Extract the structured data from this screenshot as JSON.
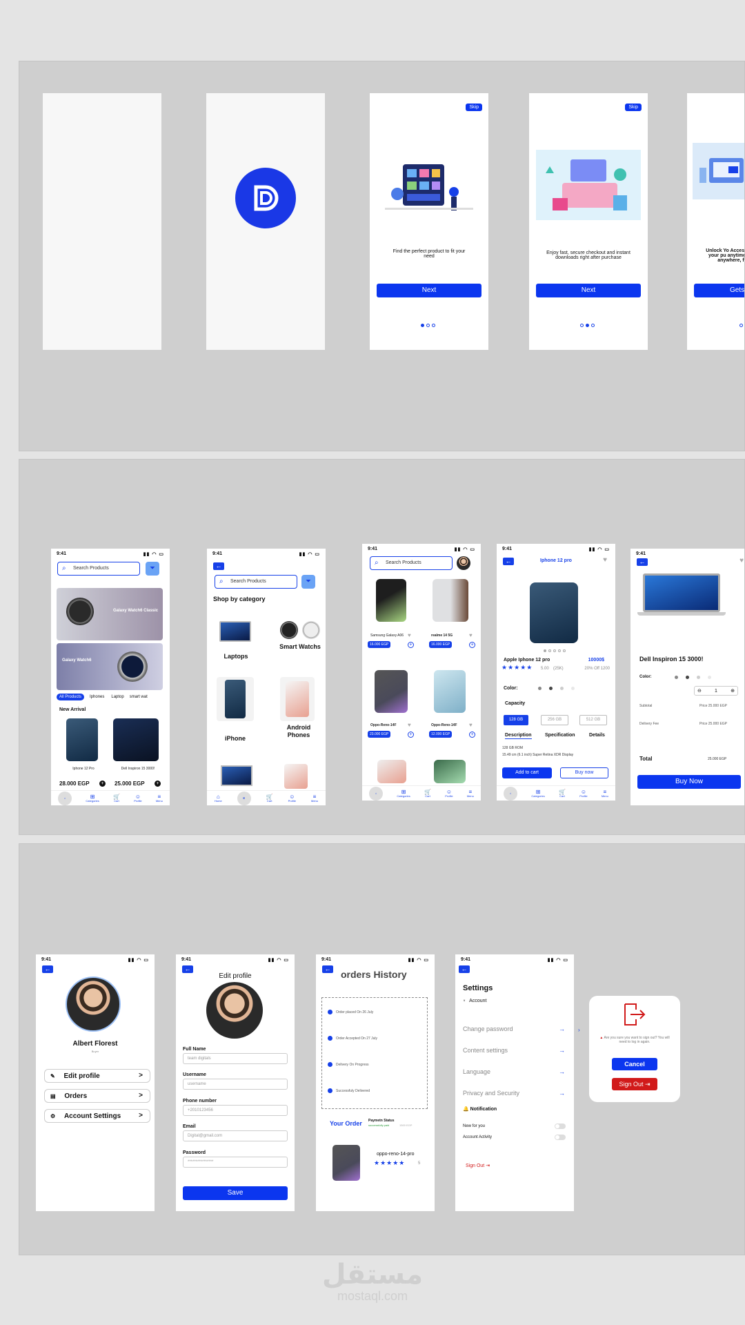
{
  "colors": {
    "accent": "#1640e8",
    "danger": "#d11a1a"
  },
  "onboarding": {
    "skip": "Skip",
    "slide1_text": "Find the perfect product to fit your need",
    "slide2_text": "Enjoy fast, secure checkout and instant downloads right after purchase",
    "slide3_text": "Unlock Yo Access your pu anytime, anywhere, fo",
    "next": "Next",
    "get_started": "Gets"
  },
  "status": {
    "time": "9:41"
  },
  "home": {
    "search_placeholder": "Search Products",
    "banner1": "Galaxy Watch6 Classic",
    "banner2": "Galaxy Watch6",
    "chips": [
      "All Products",
      "Iphones",
      "Laptop",
      "smart wat"
    ],
    "section": "New Arrival",
    "products": [
      {
        "name": "Iphone 12 Pro",
        "price": "28.000 EGP"
      },
      {
        "name": "Dell Inspiron 15 3000!",
        "price": "25.000 EGP"
      }
    ],
    "tabs": [
      "Home",
      "Categories",
      "Cart",
      "Profile",
      "Menu"
    ]
  },
  "categories": {
    "search_placeholder": "Search Products",
    "title": "Shop by category",
    "items": [
      "Laptops",
      "Smart Watchs",
      "iPhone",
      "Android Phones"
    ]
  },
  "listing": {
    "search_placeholder": "Search Products",
    "products": [
      {
        "name": "Samsung Galaxy A06",
        "price": "16.000 EGP"
      },
      {
        "name": "realme 14 5G",
        "price": "16.000 EGP"
      },
      {
        "name": "Oppo-Reno-14F",
        "price": "23.000 EGP"
      },
      {
        "name": "Oppo-Reno-14F",
        "price": "12.000 EGP"
      }
    ]
  },
  "detail": {
    "title": "Iphone 12 pro",
    "name": "Apple Iphone 12 pro",
    "price": "10000$",
    "rating": "5.00",
    "reviews": "(25K)",
    "discount": "20% Off 1200",
    "color_label": "Color:",
    "capacity_label": "Capacity",
    "capacities": [
      "128 GB",
      "256 GB",
      "512 GB"
    ],
    "tabs": [
      "Description",
      "Specification",
      "Details"
    ],
    "desc1": "128 GB ROM",
    "desc2": "15.49 cm (6.1 inch) Super Retina XDR Display",
    "add_to_cart": "Add to cart",
    "buy_now": "Buy now"
  },
  "checkout": {
    "name": "Dell Inspiron 15 3000!",
    "color_label": "Color:",
    "qty": "1",
    "subtotal_label": "Subtotal",
    "subtotal": "Price 25.000 EGP",
    "delivery_label": "Delivery Fee",
    "delivery": "Price 25.000 EGP",
    "total_label": "Total",
    "total": "25.000 EGP",
    "buy_now": "Buy Now"
  },
  "profile": {
    "name": "Albert Florest",
    "sub": "Buyer",
    "menu": [
      "Edit profile",
      "Orders",
      "Account Settings"
    ]
  },
  "edit": {
    "title": "Edit profile",
    "fields": [
      {
        "label": "Full Name",
        "value": "team digitals"
      },
      {
        "label": "Username",
        "value": "username"
      },
      {
        "label": "Phone number",
        "value": "+2010123456"
      },
      {
        "label": "Email",
        "value": "Digital@gmail.com"
      },
      {
        "label": "Password",
        "value": "****************"
      }
    ],
    "save": "Save"
  },
  "orders": {
    "title": "orders History",
    "steps": [
      "Order placed On 26 July",
      "Order Accepted On 27 July",
      "Delivery On Progress",
      "Successfuly Delivered"
    ],
    "your_order": "Your Order",
    "payment_status": "Paymetn Status",
    "payment_value": "successfully paid",
    "payment_amount": "1500 EGP",
    "product": "oppo-reno-14-pro",
    "rating": "5"
  },
  "settings": {
    "title": "Settings",
    "account": "Account",
    "items": [
      "Change password",
      "Content settings",
      "Language",
      "Privacy and Security"
    ],
    "notification": "Notification",
    "toggles": [
      "New for you",
      "Account Activity"
    ],
    "sign_out": "Sign Out"
  },
  "signout_dialog": {
    "message": "Are you sure you want to sign out? You will need to log in again.",
    "cancel": "Cancel",
    "confirm": "Sign Out"
  },
  "watermark": {
    "arabic": "مستقل",
    "latin": "mostaql.com"
  }
}
